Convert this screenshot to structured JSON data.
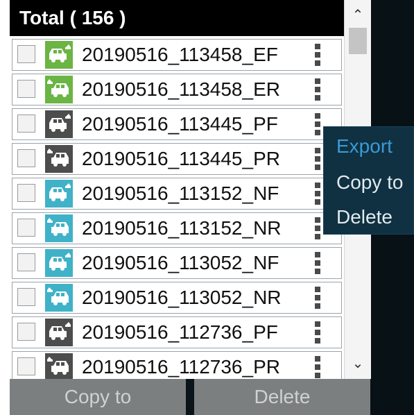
{
  "header": {
    "title": "Total ( 156 )"
  },
  "rows": [
    {
      "name": "20190516_113458_EF",
      "camera": "front",
      "color": "#6ab543"
    },
    {
      "name": "20190516_113458_ER",
      "camera": "rear",
      "color": "#6ab543"
    },
    {
      "name": "20190516_113445_PF",
      "camera": "front",
      "color": "#4d4d4d"
    },
    {
      "name": "20190516_113445_PR",
      "camera": "rear",
      "color": "#4d4d4d"
    },
    {
      "name": "20190516_113152_NF",
      "camera": "front",
      "color": "#3fb2c8"
    },
    {
      "name": "20190516_113152_NR",
      "camera": "rear",
      "color": "#3fb2c8"
    },
    {
      "name": "20190516_113052_NF",
      "camera": "front",
      "color": "#3fb2c8"
    },
    {
      "name": "20190516_113052_NR",
      "camera": "rear",
      "color": "#3fb2c8"
    },
    {
      "name": "20190516_112736_PF",
      "camera": "front",
      "color": "#4d4d4d"
    },
    {
      "name": "20190516_112736_PR",
      "camera": "rear",
      "color": "#4d4d4d"
    }
  ],
  "context_menu": {
    "items": [
      "Export",
      "Copy to",
      "Delete"
    ],
    "highlight_color": "#3a9ad6"
  },
  "bottom_bar": {
    "copy_label": "Copy to",
    "delete_label": "Delete"
  },
  "icons": {
    "scroll_up": "▲",
    "scroll_down": "▼",
    "row_icon": "car-camera-icon",
    "menu_icon": "kebab-icon"
  }
}
